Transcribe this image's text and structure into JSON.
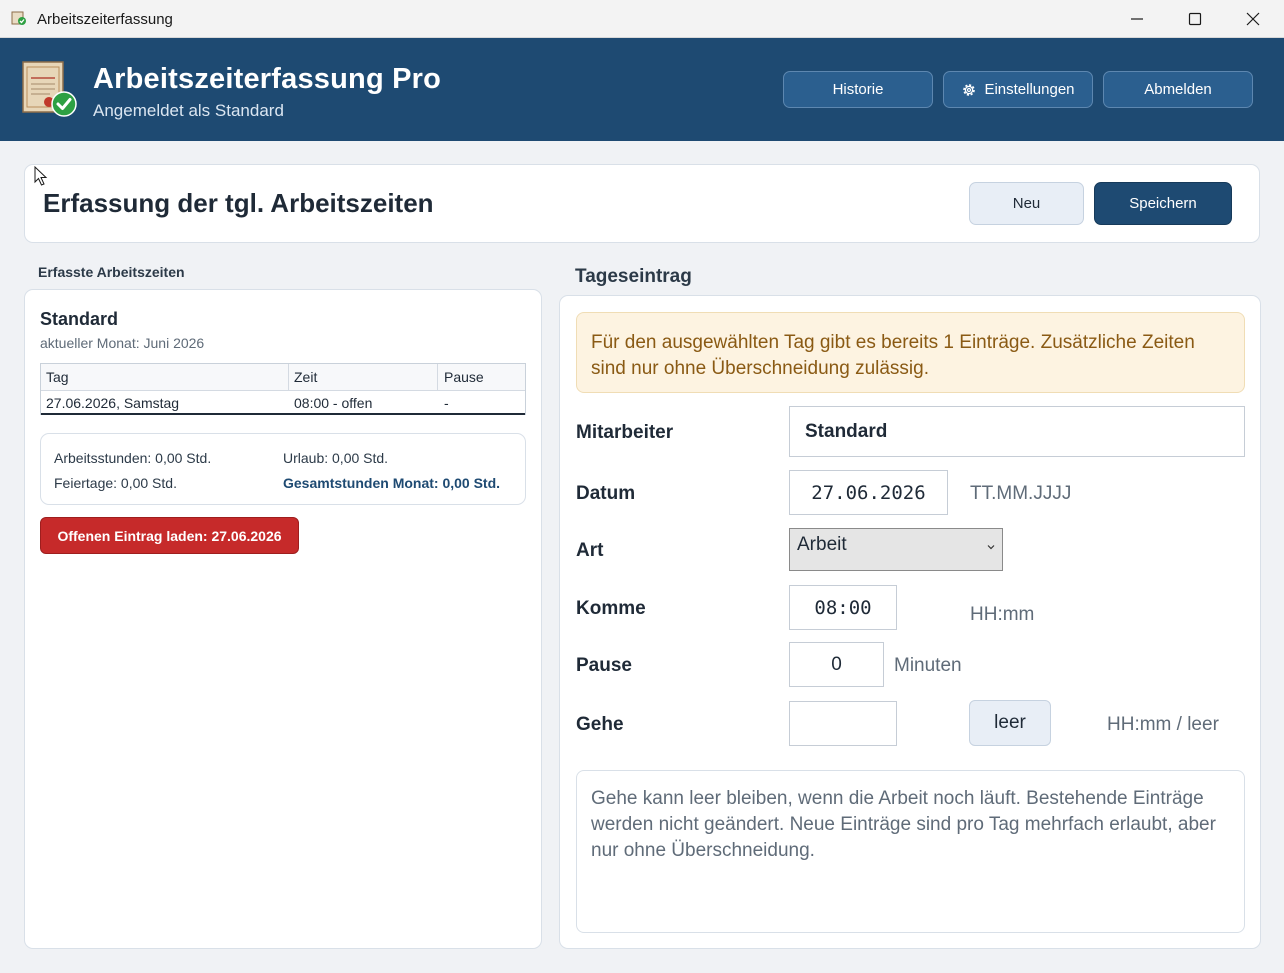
{
  "window": {
    "title": "Arbeitszeiterfassung"
  },
  "header": {
    "title": "Arbeitszeiterfassung Pro",
    "subtitle": "Angemeldet als Standard",
    "buttons": {
      "history": "Historie",
      "settings": "Einstellungen",
      "logout": "Abmelden"
    }
  },
  "page": {
    "title": "Erfassung der tgl. Arbeitszeiten",
    "new_label": "Neu",
    "save_label": "Speichern"
  },
  "left": {
    "heading": "Erfasste Arbeitszeiten",
    "employee": "Standard",
    "month": "aktueller Monat: Juni 2026",
    "columns": [
      "Tag",
      "Zeit",
      "Pause"
    ],
    "rows": [
      {
        "tag": "27.06.2026, Samstag",
        "zeit": "08:00 - offen",
        "pause": "-"
      }
    ],
    "summary": {
      "work_hours": "Arbeitsstunden: 0,00 Std.",
      "vacation": "Urlaub: 0,00 Std.",
      "holidays": "Feiertage: 0,00 Std.",
      "total": "Gesamtstunden Monat: 0,00 Std."
    },
    "open_entry_button": "Offenen Eintrag laden: 27.06.2026"
  },
  "right": {
    "heading": "Tageseintrag",
    "notice": "Für den ausgewählten Tag gibt es bereits 1 Einträge. Zusätzliche Zeiten sind nur ohne Überschneidung zulässig.",
    "fields": {
      "employee_label": "Mitarbeiter",
      "employee_value": "Standard",
      "date_label": "Datum",
      "date_value": "27.06.2026",
      "date_hint": "TT.MM.JJJJ",
      "type_label": "Art",
      "type_value": "Arbeit",
      "start_label": "Komme",
      "start_value": "08:00",
      "start_hint": "HH:mm",
      "break_label": "Pause",
      "break_value": "0",
      "break_unit": "Minuten",
      "end_label": "Gehe",
      "end_value": "",
      "clear_button": "leer",
      "end_hint": "HH:mm / leer"
    },
    "info": "Gehe kann leer bleiben, wenn die Arbeit noch läuft. Bestehende Einträge werden nicht geändert. Neue Einträge sind pro Tag mehrfach erlaubt, aber nur ohne Überschneidung."
  },
  "colors": {
    "brand": "#1e4a72",
    "danger": "#c62a2a",
    "notice_bg": "#fdf3e1",
    "notice_text": "#8a5a14"
  },
  "icons": {
    "app": "certificate-icon",
    "settings": "gear-icon",
    "minimize": "minimize-icon",
    "maximize": "maximize-icon",
    "close": "close-icon",
    "select": "chevron-down-icon"
  }
}
